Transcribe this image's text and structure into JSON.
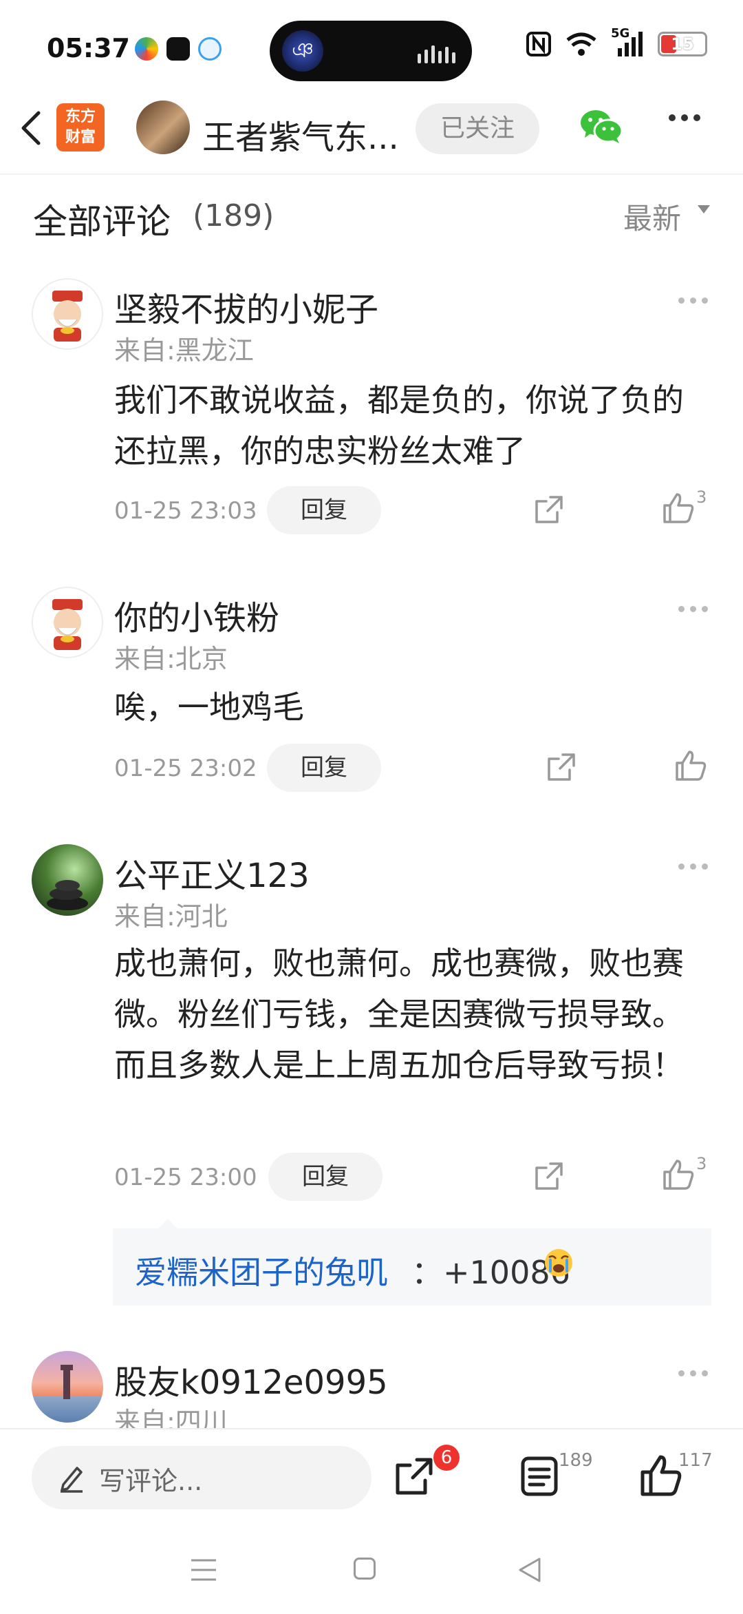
{
  "status_bar": {
    "time": "05:37",
    "network": "5G",
    "battery": "15",
    "icons": [
      "nfc-icon",
      "wifi-icon",
      "signal-icon",
      "battery-icon"
    ]
  },
  "header": {
    "logo_line1": "东方",
    "logo_line2": "财富",
    "author_name": "王者紫气东...",
    "follow_label": "已关注",
    "icons": [
      "back-icon",
      "wechat-icon",
      "more-icon"
    ]
  },
  "comments": {
    "title": "全部评论",
    "count": "(189)",
    "sort_label": "最新",
    "items": [
      {
        "name": "坚毅不拔的小妮子",
        "location": "来自:黑龙江",
        "text": "我们不敢说收益，都是负的，你说了负的还拉黑，你的忠实粉丝太难了",
        "time": "01-25 23:03",
        "reply_label": "回复",
        "likes": "3"
      },
      {
        "name": "你的小铁粉",
        "location": "来自:北京",
        "text": "唉，一地鸡毛",
        "time": "01-25 23:02",
        "reply_label": "回复",
        "likes": ""
      },
      {
        "name": "公平正义123",
        "location": "来自:河北",
        "text": "成也萧何，败也萧何。成也赛微，败也赛微。粉丝们亏钱，全是因赛微亏损导致。而且多数人是上上周五加仓后导致亏损！",
        "time": "01-25 23:00",
        "reply_label": "回复",
        "likes": "3",
        "sub_reply": {
          "user": "爱糯米团子的兔叽",
          "text": "：+10086"
        }
      },
      {
        "name": "股友k0912e0995",
        "location": "来自:四川"
      }
    ]
  },
  "bottom_bar": {
    "comment_placeholder": "写评论...",
    "share_badge": "6",
    "comment_count": "189",
    "like_count": "117"
  },
  "colors": {
    "brand": "#f26522",
    "link_blue": "#1d64c8",
    "badge_red": "#f0322d",
    "wechat_green": "#3cc13b"
  }
}
